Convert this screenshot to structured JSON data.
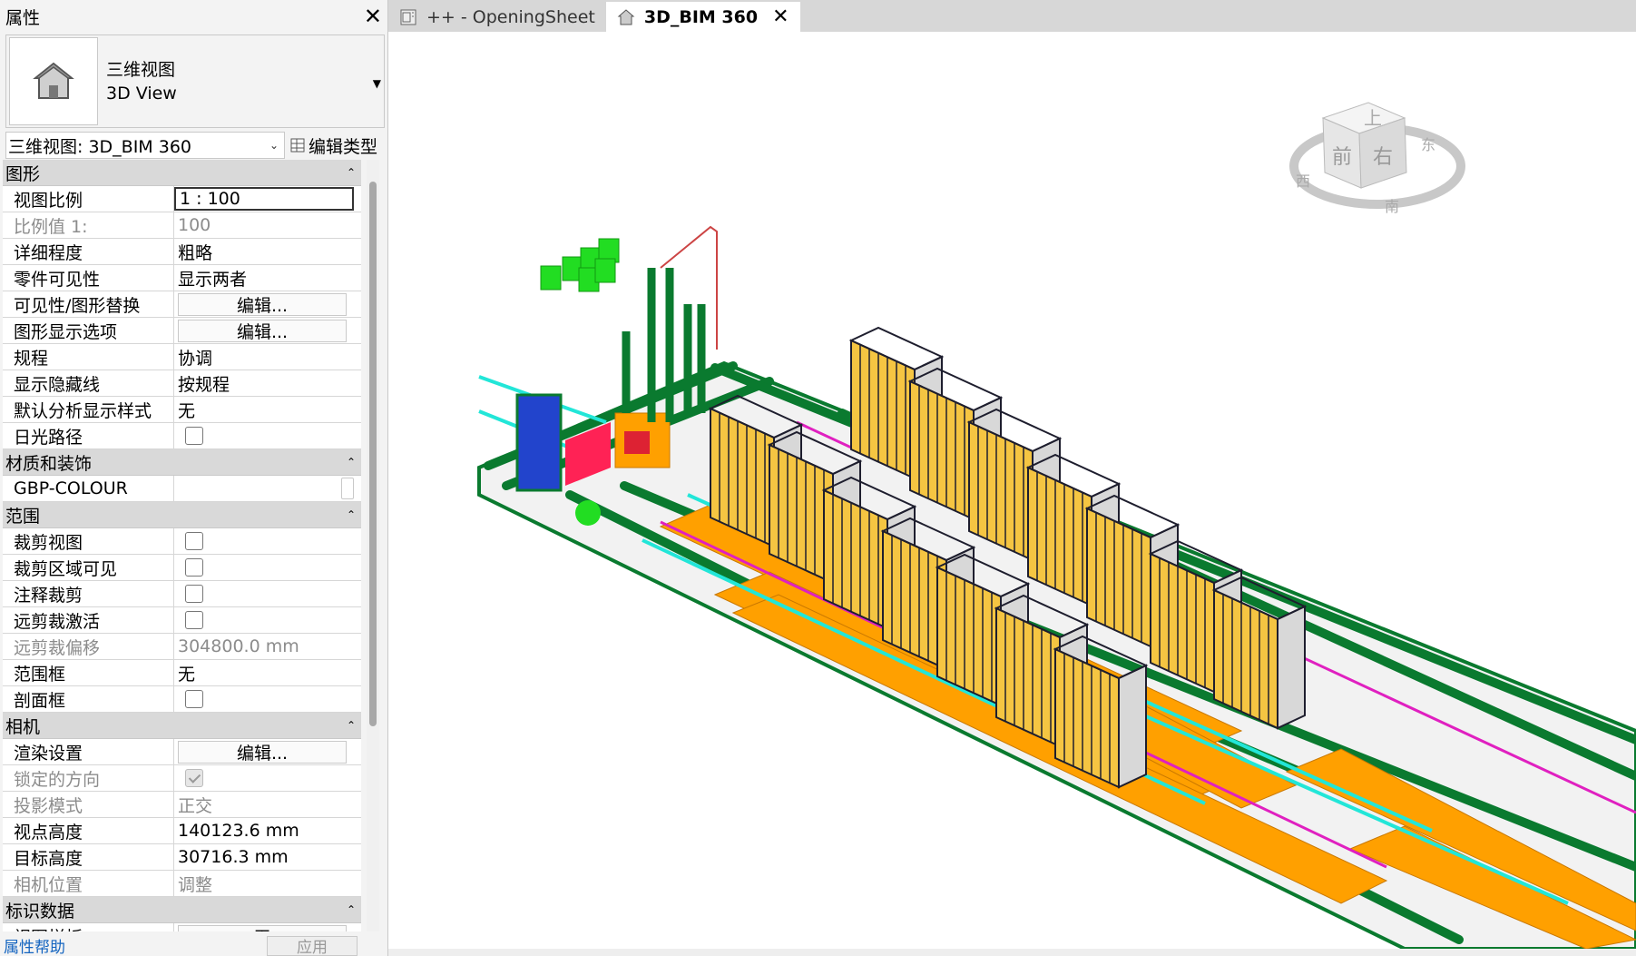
{
  "palette": {
    "title": "属性",
    "type_name_cn": "三维视图",
    "type_name_en": "3D View",
    "instance_selector": "三维视图: 3D_BIM 360",
    "edit_type": "编辑类型",
    "categories": [
      {
        "name": "图形",
        "rows": [
          {
            "k": "视图比例",
            "v": "1 : 100",
            "kind": "boxed"
          },
          {
            "k": "比例值 1:",
            "v": "100",
            "kind": "dis"
          },
          {
            "k": "详细程度",
            "v": "粗略"
          },
          {
            "k": "零件可见性",
            "v": "显示两者"
          },
          {
            "k": "可见性/图形替换",
            "v": "编辑...",
            "kind": "button"
          },
          {
            "k": "图形显示选项",
            "v": "编辑...",
            "kind": "button"
          },
          {
            "k": "规程",
            "v": "协调"
          },
          {
            "k": "显示隐藏线",
            "v": "按规程"
          },
          {
            "k": "默认分析显示样式",
            "v": "无"
          },
          {
            "k": "日光路径",
            "v": "",
            "kind": "check"
          }
        ]
      },
      {
        "name": "材质和装饰",
        "rows": [
          {
            "k": "GBP-COLOUR",
            "v": "",
            "kind": "minibox"
          }
        ]
      },
      {
        "name": "范围",
        "rows": [
          {
            "k": "裁剪视图",
            "v": "",
            "kind": "check"
          },
          {
            "k": "裁剪区域可见",
            "v": "",
            "kind": "check"
          },
          {
            "k": "注释裁剪",
            "v": "",
            "kind": "check"
          },
          {
            "k": "远剪裁激活",
            "v": "",
            "kind": "check"
          },
          {
            "k": "远剪裁偏移",
            "v": "304800.0 mm",
            "kind": "dis"
          },
          {
            "k": "范围框",
            "v": "无"
          },
          {
            "k": "剖面框",
            "v": "",
            "kind": "check"
          }
        ]
      },
      {
        "name": "相机",
        "rows": [
          {
            "k": "渲染设置",
            "v": "编辑...",
            "kind": "button"
          },
          {
            "k": "锁定的方向",
            "v": "",
            "kind": "checkdis"
          },
          {
            "k": "投影模式",
            "v": "正交",
            "kind": "dis"
          },
          {
            "k": "视点高度",
            "v": "140123.6 mm"
          },
          {
            "k": "目标高度",
            "v": "30716.3 mm"
          },
          {
            "k": "相机位置",
            "v": "调整",
            "kind": "dis"
          }
        ]
      },
      {
        "name": "标识数据",
        "rows": [
          {
            "k": "视图样板",
            "v": "<无>",
            "kind": "button"
          }
        ]
      }
    ],
    "help": "属性帮助",
    "apply": "应用"
  },
  "tabs": [
    {
      "label": "++ - OpeningSheet",
      "icon": "sheet-icon",
      "active": false
    },
    {
      "label": "3D_BIM 360",
      "icon": "house-icon",
      "active": true
    }
  ],
  "viewcube": {
    "top": "上",
    "front": "前",
    "right": "右",
    "east": "东",
    "west": "西",
    "south": "南"
  },
  "colors": {
    "pipe_green": "#0a7a2f",
    "tray_orange": "#ffa000",
    "equip_yellow": "#f5c542",
    "frame_dark": "#1e1e2e",
    "cyan": "#22e6d8",
    "magenta": "#e020c0",
    "bright_green": "#22dd22"
  }
}
